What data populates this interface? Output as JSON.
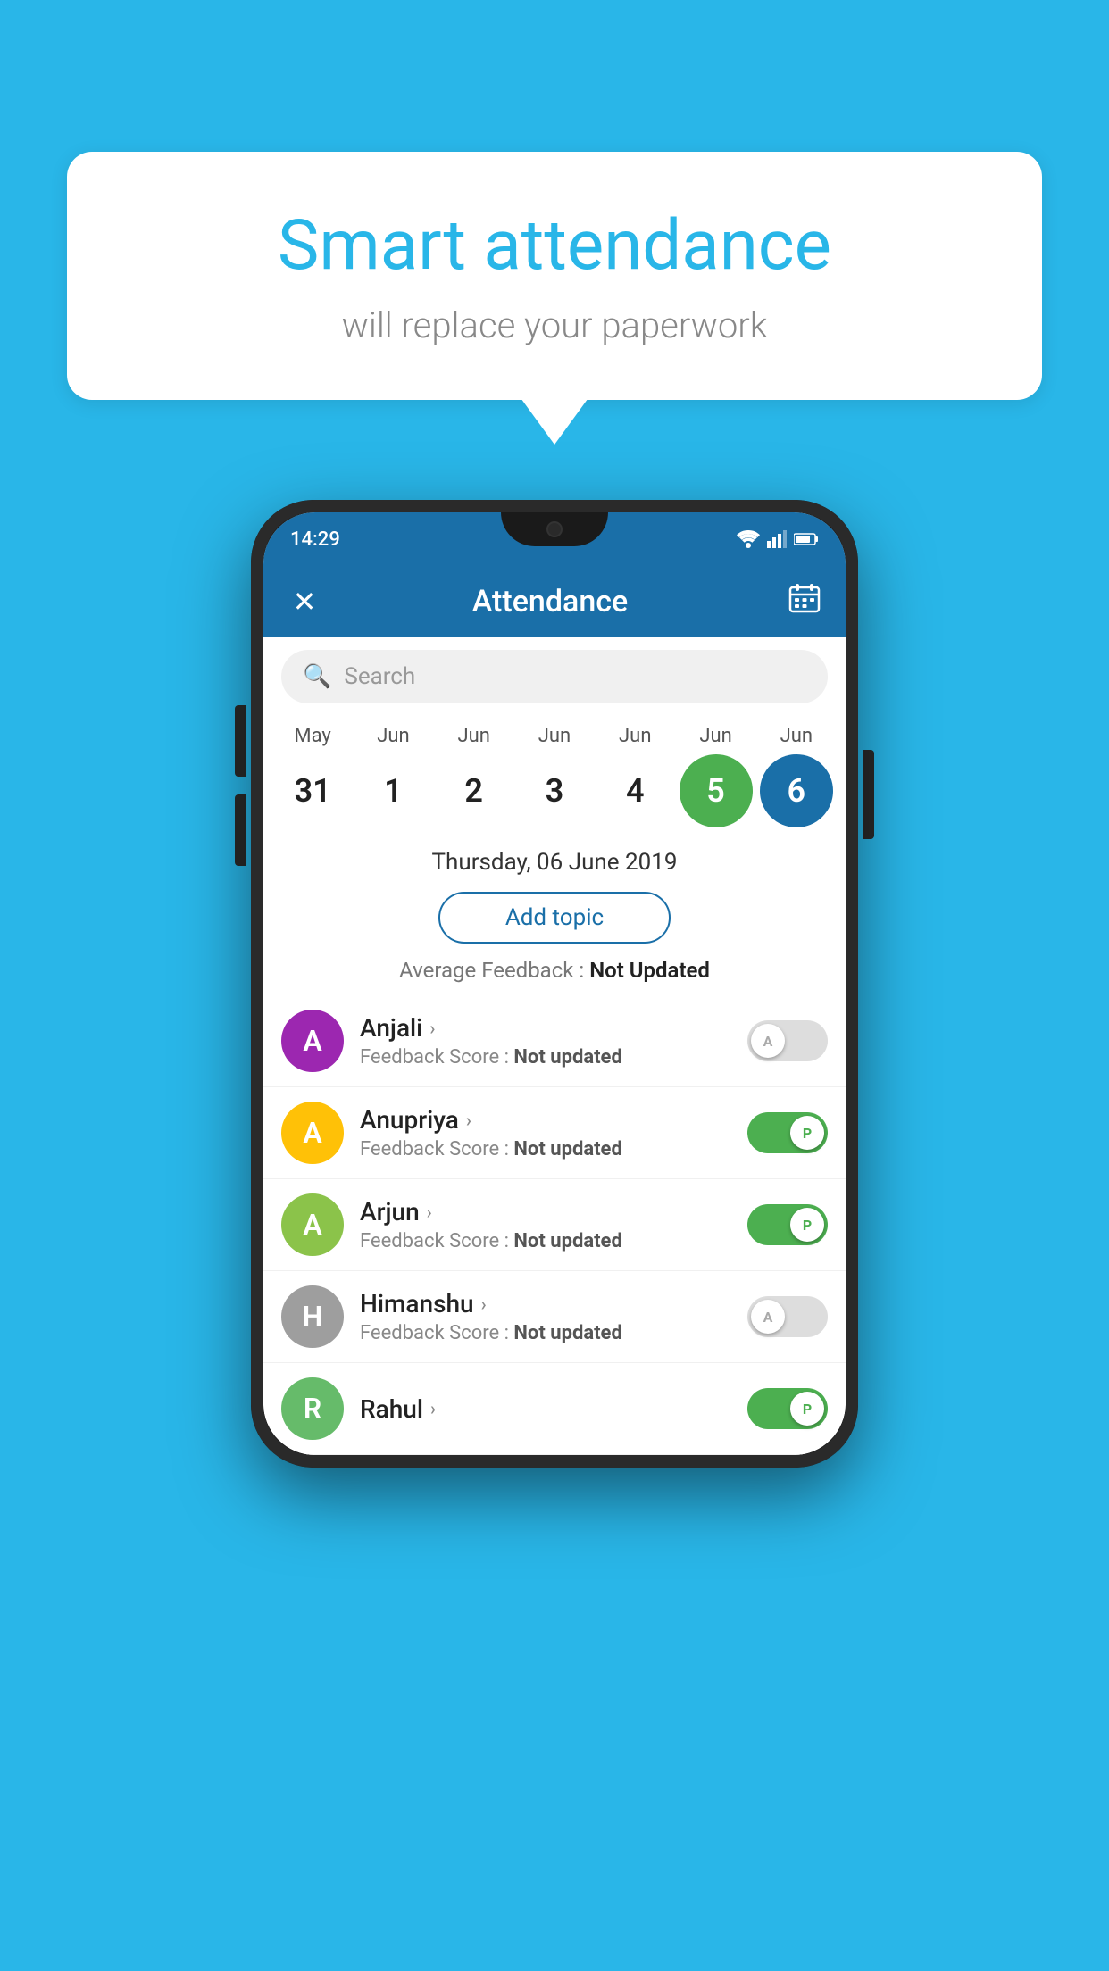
{
  "background_color": "#29B6E8",
  "speech_bubble": {
    "title": "Smart attendance",
    "subtitle": "will replace your paperwork"
  },
  "status_bar": {
    "time": "14:29",
    "icons": [
      "wifi",
      "signal",
      "battery"
    ]
  },
  "app_bar": {
    "title": "Attendance",
    "close_icon": "✕",
    "calendar_icon": "📅"
  },
  "search": {
    "placeholder": "Search"
  },
  "calendar": {
    "months": [
      "May",
      "Jun",
      "Jun",
      "Jun",
      "Jun",
      "Jun",
      "Jun"
    ],
    "dates": [
      "31",
      "1",
      "2",
      "3",
      "4",
      "5",
      "6"
    ],
    "today_index": 5,
    "selected_index": 6
  },
  "selected_date": {
    "text": "Thursday, 06 June 2019"
  },
  "add_topic_button": "Add topic",
  "avg_feedback": {
    "label": "Average Feedback : ",
    "value": "Not Updated"
  },
  "students": [
    {
      "name": "Anjali",
      "avatar_letter": "A",
      "avatar_color": "#9C27B0",
      "feedback_label": "Feedback Score : ",
      "feedback_value": "Not updated",
      "toggle_state": "off",
      "toggle_letter": "A"
    },
    {
      "name": "Anupriya",
      "avatar_letter": "A",
      "avatar_color": "#FFC107",
      "feedback_label": "Feedback Score : ",
      "feedback_value": "Not updated",
      "toggle_state": "on",
      "toggle_letter": "P"
    },
    {
      "name": "Arjun",
      "avatar_letter": "A",
      "avatar_color": "#8BC34A",
      "feedback_label": "Feedback Score : ",
      "feedback_value": "Not updated",
      "toggle_state": "on",
      "toggle_letter": "P"
    },
    {
      "name": "Himanshu",
      "avatar_letter": "H",
      "avatar_color": "#9E9E9E",
      "feedback_label": "Feedback Score : ",
      "feedback_value": "Not updated",
      "toggle_state": "off",
      "toggle_letter": "A"
    }
  ]
}
